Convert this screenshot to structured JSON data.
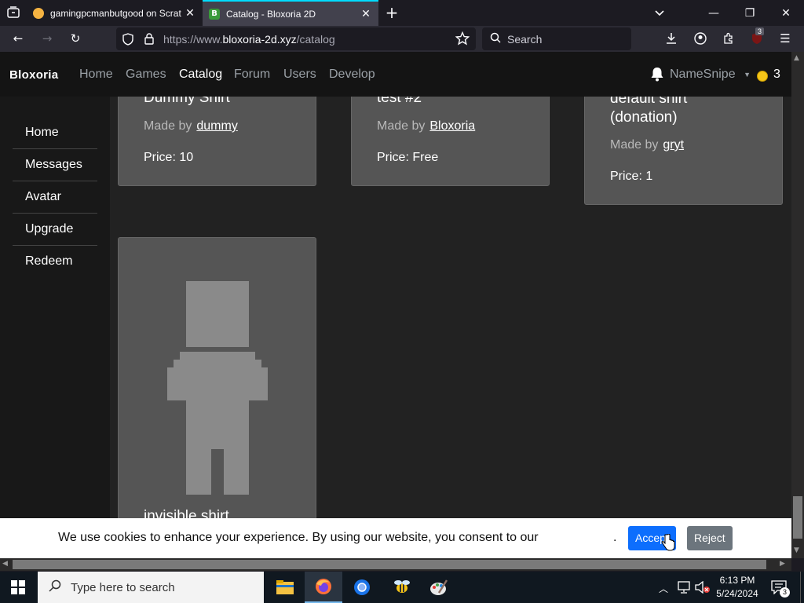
{
  "browser": {
    "tabs": [
      {
        "title": "gamingpcmanbutgood on Scrat",
        "active": false
      },
      {
        "title": "Catalog - Bloxoria 2D",
        "active": true
      }
    ],
    "url_prefix": "https://www.",
    "url_domain": "bloxoria-2d.xyz",
    "url_path": "/catalog",
    "search_placeholder": "Search",
    "extension_badge": "3"
  },
  "site": {
    "brand": "Bloxoria",
    "nav": [
      "Home",
      "Games",
      "Catalog",
      "Forum",
      "Users",
      "Develop"
    ],
    "active_nav": "Catalog",
    "username": "NameSnipe",
    "coins": "3"
  },
  "sidebar": {
    "items": [
      "Home",
      "Messages",
      "Avatar",
      "Upgrade",
      "Redeem"
    ]
  },
  "catalog": {
    "items": [
      {
        "title": "Dummy Shirt",
        "made_by_label": "Made by",
        "creator": "dummy",
        "price_label": "Price:",
        "price": "10"
      },
      {
        "title": "test #2",
        "made_by_label": "Made by",
        "creator": "Bloxoria",
        "price_label": "Price:",
        "price": "Free"
      },
      {
        "title_line1": "default shirt",
        "title_line2": "(donation)",
        "made_by_label": "Made by",
        "creator": "gryt",
        "price_label": "Price:",
        "price": "1"
      },
      {
        "title": "invisible shirt"
      }
    ]
  },
  "cookie_banner": {
    "message": "We use cookies to enhance your experience. By using our website, you consent to our",
    "trailing": ".",
    "accept_label": "Accept",
    "reject_label": "Reject"
  },
  "taskbar": {
    "search_placeholder": "Type here to search",
    "time": "6:13 PM",
    "date": "5/24/2024",
    "notification_count": "3"
  },
  "colors": {
    "accept_button": "#0d6efd",
    "reject_button": "#6c757d",
    "active_tab_accent": "#00ddff",
    "coin": "#f5c518"
  }
}
